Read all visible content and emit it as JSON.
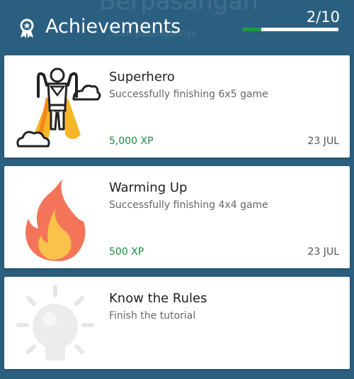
{
  "background": {
    "title": "Berpasangan",
    "subtitle": "...cari pasangannya"
  },
  "header": {
    "title": "Achievements",
    "icon": "ribbon-award-icon",
    "counter": "2/10",
    "progress": 0.2,
    "colors": {
      "background": "#2b5f80",
      "progress_fill": "#1b9a4a",
      "progress_track": "#ffffff"
    }
  },
  "achievements": [
    {
      "title": "Superhero",
      "description": "Successfully finishing 6x5 game",
      "xp": "5,000 XP",
      "date": "23 JUL",
      "icon": "superhero-icon",
      "unlocked": true
    },
    {
      "title": "Warming Up",
      "description": "Successfully finishing 4x4 game",
      "xp": "500 XP",
      "date": "23 JUL",
      "icon": "flame-icon",
      "unlocked": true
    },
    {
      "title": "Know the Rules",
      "description": "Finish the tutorial",
      "icon": "lightbulb-icon",
      "unlocked": false
    }
  ]
}
